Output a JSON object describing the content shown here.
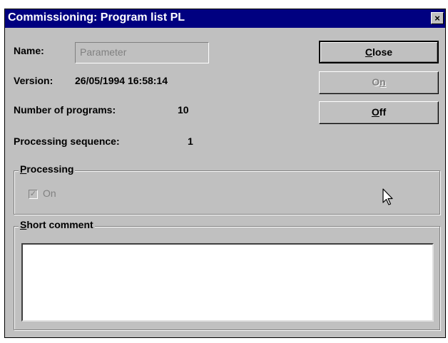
{
  "window": {
    "title": "Commissioning: Program list PL",
    "close_glyph": "×"
  },
  "fields": {
    "name_label": "Name:",
    "name_value": "Parameter",
    "version_label": "Version:",
    "version_value": "26/05/1994 16:58:14",
    "programs_label": "Number of programs:",
    "programs_value": "10",
    "sequence_label": "Processing sequence:",
    "sequence_value": "1"
  },
  "buttons": {
    "close_mn": "C",
    "close_rest": "lose",
    "on_pre": "O",
    "on_mn": "n",
    "off_mn": "O",
    "off_rest": "ff"
  },
  "processing": {
    "label_mn": "P",
    "label_rest": "rocessing",
    "checkbox_label": "On",
    "checked": true,
    "check_glyph": "✓"
  },
  "short_comment": {
    "label_mn": "S",
    "label_rest": "hort comment",
    "value": ""
  },
  "icons": {
    "close": "close-icon",
    "cursor": "mouse-pointer-icon",
    "check": "checkmark-icon"
  }
}
